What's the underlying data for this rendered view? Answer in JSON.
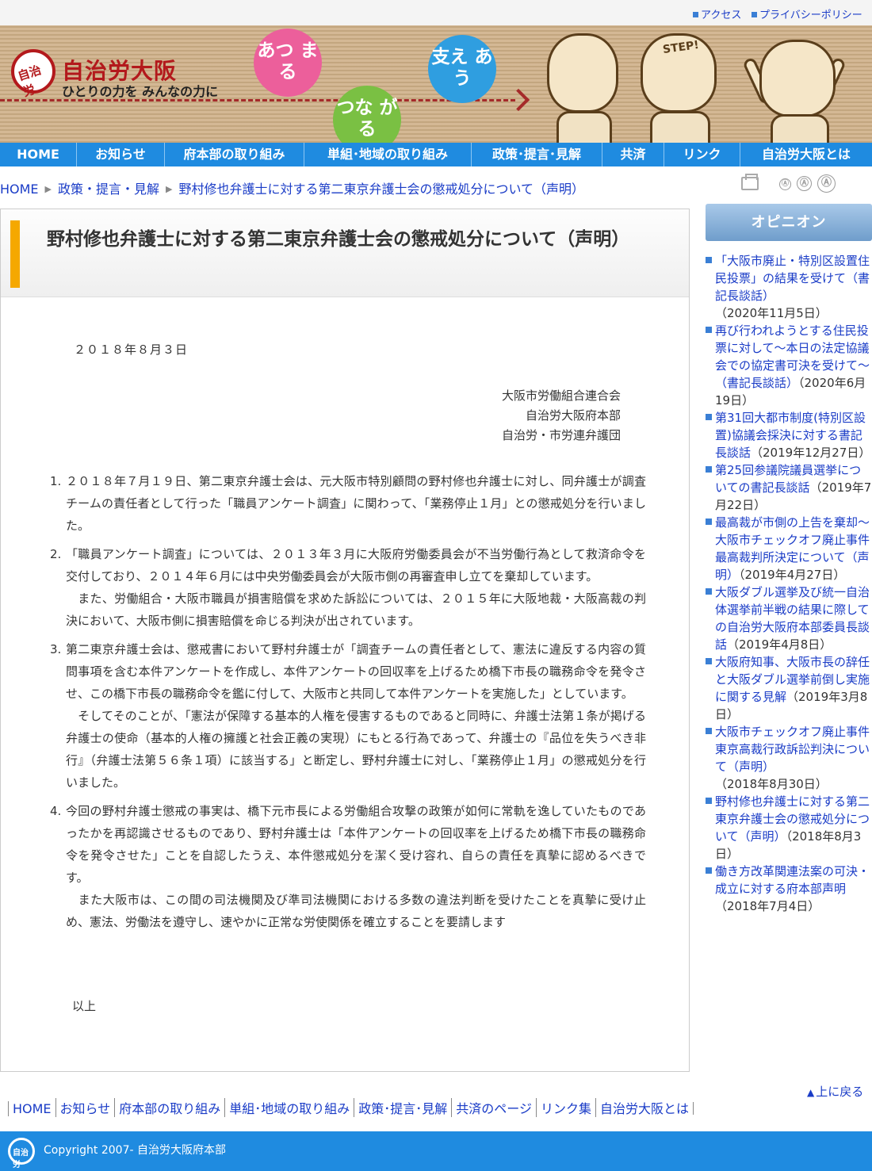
{
  "top_links": [
    "アクセス",
    "プライバシーポリシー"
  ],
  "brand": {
    "logo_mark": "自治労",
    "title": "自治労大阪",
    "subtitle": "ひとりの力を みんなの力に",
    "bubbles": [
      "あつ まる",
      "つな がる",
      "支え あう"
    ],
    "step": "STEP!"
  },
  "nav": [
    "HOME",
    "お知らせ",
    "府本部の取り組み",
    "単組･地域の取り組み",
    "政策･提言･見解",
    "共済",
    "リンク",
    "自治労大阪とは"
  ],
  "breadcrumb": [
    "HOME",
    "政策・提言・見解",
    "野村修也弁護士に対する第二東京弁護士会の懲戒処分について（声明）"
  ],
  "font_size_controls": [
    "Ⓐ",
    "Ⓐ",
    "Ⓐ"
  ],
  "article": {
    "title": "野村修也弁護士に対する第二東京弁護士会の懲戒処分について（声明）",
    "date": "２０１８年８月３日",
    "signers": [
      "大阪市労働組合連合会",
      "自治労大阪府本部",
      "自治労・市労連弁護団"
    ],
    "items": [
      {
        "num": "1.",
        "paras": [
          "２０１８年７月１９日、第二東京弁護士会は、元大阪市特別顧問の野村修也弁護士に対し、同弁護士が調査チームの責任者として行った「職員アンケート調査」に関わって、「業務停止１月」との懲戒処分を行いました。"
        ]
      },
      {
        "num": "2.",
        "paras": [
          "「職員アンケート調査」については、２０１３年３月に大阪府労働委員会が不当労働行為として救済命令を交付しており、２０１４年６月には中央労働委員会が大阪市側の再審査申し立てを棄却しています。",
          "　また、労働組合・大阪市職員が損害賠償を求めた訴訟については、２０１５年に大阪地裁・大阪高裁の判決において、大阪市側に損害賠償を命じる判決が出されています。"
        ]
      },
      {
        "num": "3.",
        "paras": [
          "第二東京弁護士会は、懲戒書において野村弁護士が「調査チームの責任者として、憲法に違反する内容の質問事項を含む本件アンケートを作成し、本件アンケートの回収率を上げるため橋下市長の職務命令を発令させ、この橋下市長の職務命令を鑑に付して、大阪市と共同して本件アンケートを実施した」としています。",
          "　そしてそのことが、「憲法が保障する基本的人権を侵害するものであると同時に、弁護士法第１条が掲げる弁護士の使命（基本的人権の擁護と社会正義の実現）にもとる行為であって、弁護士の『品位を失うべき非行』（弁護士法第５６条１項）に該当する」と断定し、野村弁護士に対し、「業務停止１月」の懲戒処分を行いました。"
        ]
      },
      {
        "num": "4.",
        "paras": [
          "今回の野村弁護士懲戒の事実は、橋下元市長による労働組合攻撃の政策が如何に常軌を逸していたものであったかを再認識させるものであり、野村弁護士は「本件アンケートの回収率を上げるため橋下市長の職務命令を発令させた」ことを自認したうえ、本件懲戒処分を潔く受け容れ、自らの責任を真摯に認めるべきです。",
          "　また大阪市は、この間の司法機関及び準司法機関における多数の違法判断を受けたことを真摯に受け止め、憲法、労働法を遵守し、速やかに正常な労使関係を確立することを要請します"
        ]
      }
    ],
    "closing": "以上"
  },
  "sidebar": {
    "heading": "オピニオン",
    "items": [
      {
        "title": "「大阪市廃止・特別区設置住民投票」の結果を受けて（書記長談話）",
        "date": "（2020年11月5日）"
      },
      {
        "title": "再び行われようとする住民投票に対して～本日の法定協議会での協定書可決を受けて～（書記長談話）",
        "date": "（2020年6月19日）"
      },
      {
        "title": "第31回大都市制度(特別区設置)協議会採決に対する書記長談話",
        "date": "（2019年12月27日）"
      },
      {
        "title": "第25回参議院議員選挙についての書記長談話",
        "date": "（2019年7月22日）"
      },
      {
        "title": "最高裁が市側の上告を棄却～大阪市チェックオフ廃止事件最高裁判所決定について（声明）",
        "date": "（2019年4月27日）"
      },
      {
        "title": "大阪ダブル選挙及び統一自治体選挙前半戦の結果に際しての自治労大阪府本部委員長談話",
        "date": "（2019年4月8日）"
      },
      {
        "title": "大阪府知事、大阪市長の辞任と大阪ダブル選挙前倒し実施に関する見解",
        "date": "（2019年3月8日）"
      },
      {
        "title": "大阪市チェックオフ廃止事件東京高裁行政訴訟判決について（声明）",
        "date": "（2018年8月30日）"
      },
      {
        "title": "野村修也弁護士に対する第二東京弁護士会の懲戒処分について（声明）",
        "date": "（2018年8月3日）"
      },
      {
        "title": "働き方改革関連法案の可決・成立に対する府本部声明",
        "date": "（2018年7月4日）"
      }
    ]
  },
  "footer": {
    "page_top": "上に戻る",
    "links": [
      "HOME",
      "お知らせ",
      "府本部の取り組み",
      "単組･地域の取り組み",
      "政策･提言･見解",
      "共済のページ",
      "リンク集",
      "自治労大阪とは"
    ],
    "logo_mark": "自治労",
    "copyright": "Copyright 2007- 自治労大阪府本部"
  },
  "colors": {
    "nav": "#1f8be0",
    "accent_bar": "#f5a800",
    "link": "#1a3cc7",
    "brand_red": "#b3191c"
  },
  "icons": [
    "print-icon",
    "font-size-icon"
  ]
}
